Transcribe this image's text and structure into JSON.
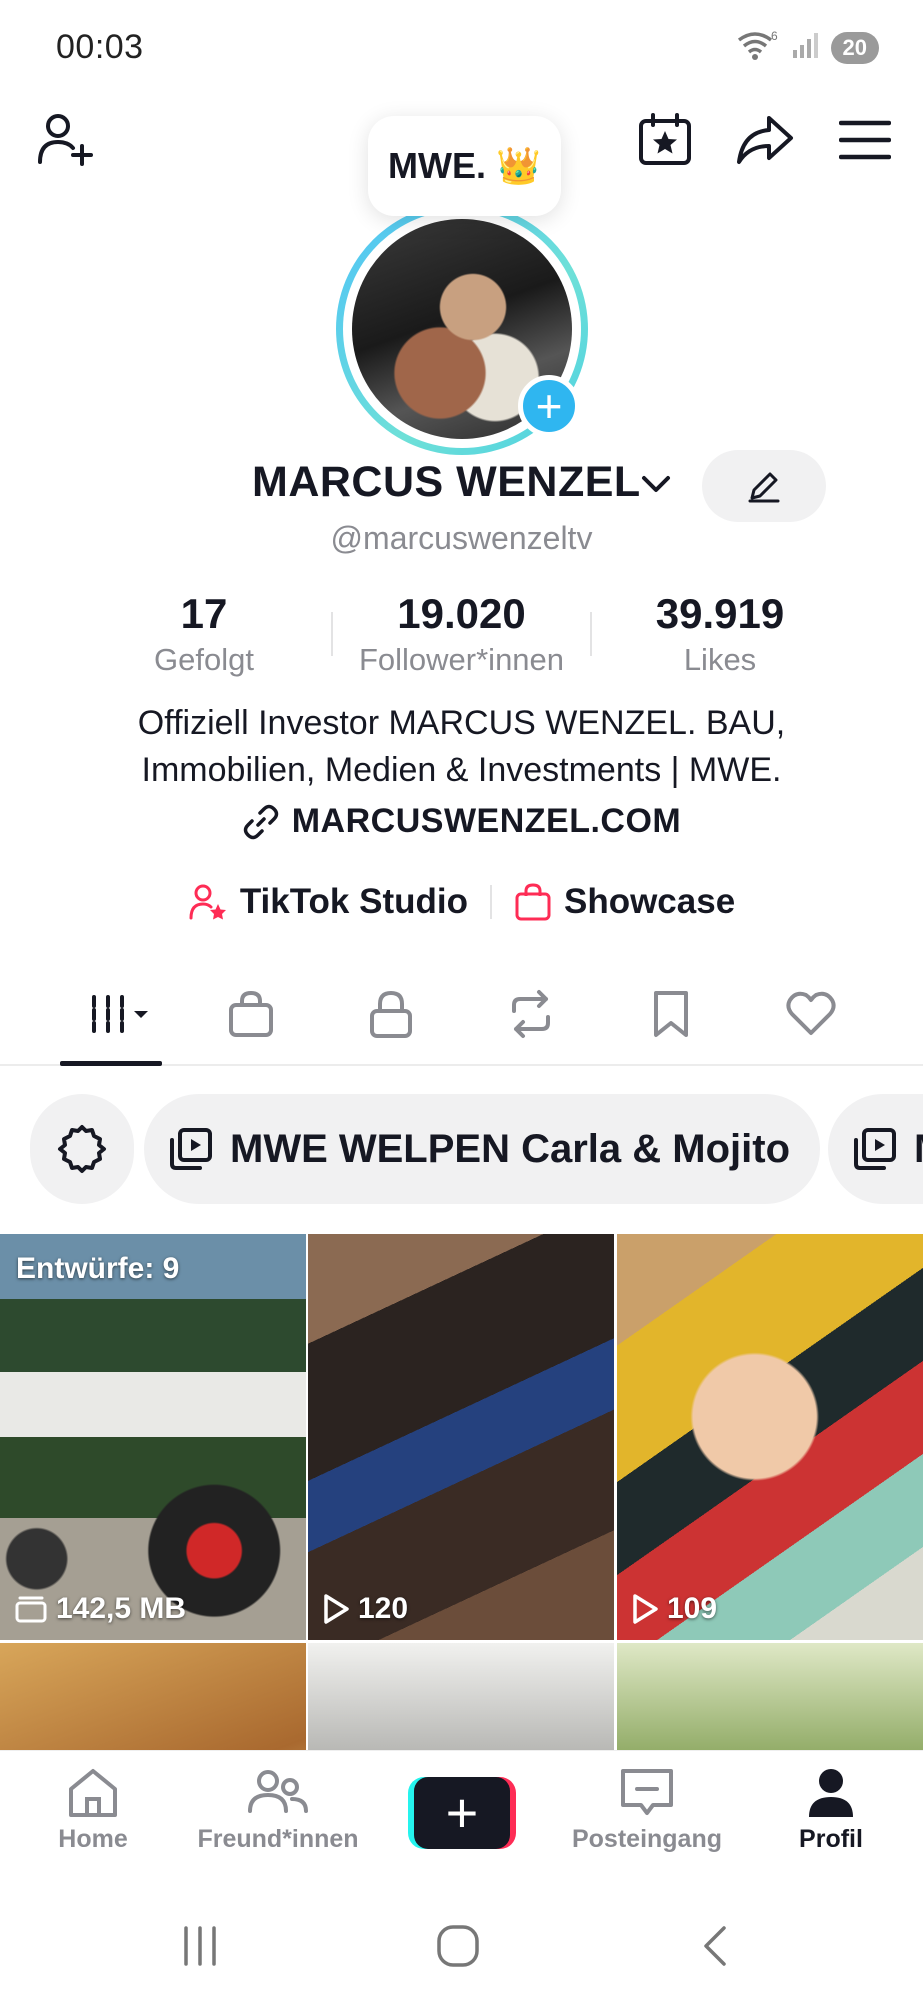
{
  "status_bar": {
    "time": "00:03",
    "wifi_badge": "6",
    "battery": "20"
  },
  "note": {
    "text": "MWE. 👑"
  },
  "profile": {
    "display_name": "MARCUS WENZEL",
    "username": "@marcuswenzeltv",
    "stats": [
      {
        "value": "17",
        "label": "Gefolgt"
      },
      {
        "value": "19.020",
        "label": "Follower*innen"
      },
      {
        "value": "39.919",
        "label": "Likes"
      }
    ],
    "bio_line1": "Offiziell Investor MARCUS WENZEL. BAU,",
    "bio_line2": "Immobilien, Medien & Investments | MWE.",
    "link": "MARCUSWENZEL.COM"
  },
  "tools": {
    "studio_label": "TikTok Studio",
    "showcase_label": "Showcase"
  },
  "tabs": [
    "videos",
    "shop",
    "private",
    "reposts",
    "favorites",
    "liked"
  ],
  "collections": {
    "chip1": "MWE WELPEN Carla & Mojito",
    "chip2": "M"
  },
  "videos": [
    {
      "top_label": "Entwürfe: 9",
      "bottom_label": "142,5 MB",
      "bottom_icon": "drafts-icon"
    },
    {
      "bottom_label": "120",
      "bottom_icon": "play-icon"
    },
    {
      "bottom_label": "109",
      "bottom_icon": "play-icon"
    },
    {
      "bottom_label": ""
    },
    {
      "bottom_label": ""
    },
    {
      "bottom_label": ""
    }
  ],
  "bottom_nav": {
    "home": "Home",
    "friends": "Freund*innen",
    "inbox": "Posteingang",
    "profile": "Profil"
  },
  "colors": {
    "accent_red": "#fe2c55",
    "accent_cyan": "#25f4ee",
    "text": "#161823",
    "muted": "#8a8b91"
  }
}
